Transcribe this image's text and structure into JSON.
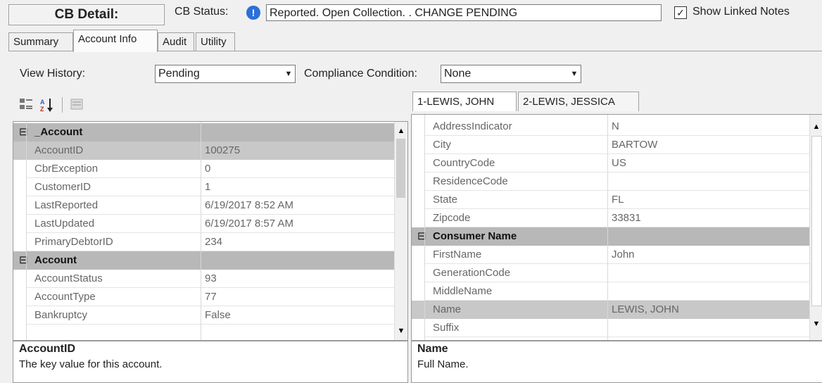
{
  "header": {
    "title": "CB Detail:",
    "status_label": "CB Status:",
    "status_value": "Reported. Open Collection. . CHANGE PENDING",
    "show_linked_notes_label": "Show Linked Notes",
    "show_linked_notes_checked": true
  },
  "tabs": [
    "Summary",
    "Account Info",
    "Audit",
    "Utility"
  ],
  "active_tab": "Account Info",
  "filters": {
    "view_history_label": "View History:",
    "view_history_value": "Pending",
    "compliance_label": "Compliance Condition:",
    "compliance_value": "None"
  },
  "toolbar": {
    "categorized_icon": "categorized-icon",
    "alphabetical_icon": "az-sort-icon",
    "property_pages_icon": "property-pages-icon"
  },
  "left_grid": {
    "rows": [
      {
        "type": "cat",
        "name": "_Account"
      },
      {
        "name": "AccountID",
        "value": "100275",
        "selected": true
      },
      {
        "name": "CbrException",
        "value": "0"
      },
      {
        "name": "CustomerID",
        "value": "1"
      },
      {
        "name": "LastReported",
        "value": "6/19/2017 8:52 AM"
      },
      {
        "name": "LastUpdated",
        "value": "6/19/2017 8:57 AM"
      },
      {
        "name": "PrimaryDebtorID",
        "value": "234"
      },
      {
        "type": "cat",
        "name": "Account"
      },
      {
        "name": "AccountStatus",
        "value": "93"
      },
      {
        "name": "AccountType",
        "value": "77"
      },
      {
        "name": "Bankruptcy",
        "value": "False"
      }
    ],
    "description": {
      "title": "AccountID",
      "text": "The key value for this account."
    }
  },
  "person_tabs": [
    "1-LEWIS, JOHN",
    "2-LEWIS, JESSICA"
  ],
  "active_person_tab": "1-LEWIS, JOHN",
  "right_grid": {
    "rows": [
      {
        "name": "AddressIndicator",
        "value": "N"
      },
      {
        "name": "City",
        "value": "BARTOW"
      },
      {
        "name": "CountryCode",
        "value": "US"
      },
      {
        "name": "ResidenceCode",
        "value": ""
      },
      {
        "name": "State",
        "value": "FL"
      },
      {
        "name": "Zipcode",
        "value": "33831"
      },
      {
        "type": "cat",
        "name": "Consumer Name"
      },
      {
        "name": "FirstName",
        "value": "John"
      },
      {
        "name": "GenerationCode",
        "value": ""
      },
      {
        "name": "MiddleName",
        "value": ""
      },
      {
        "name": "Name",
        "value": "LEWIS, JOHN",
        "selected": true
      },
      {
        "name": "Suffix",
        "value": ""
      }
    ],
    "description": {
      "title": "Name",
      "text": "Full Name."
    }
  }
}
